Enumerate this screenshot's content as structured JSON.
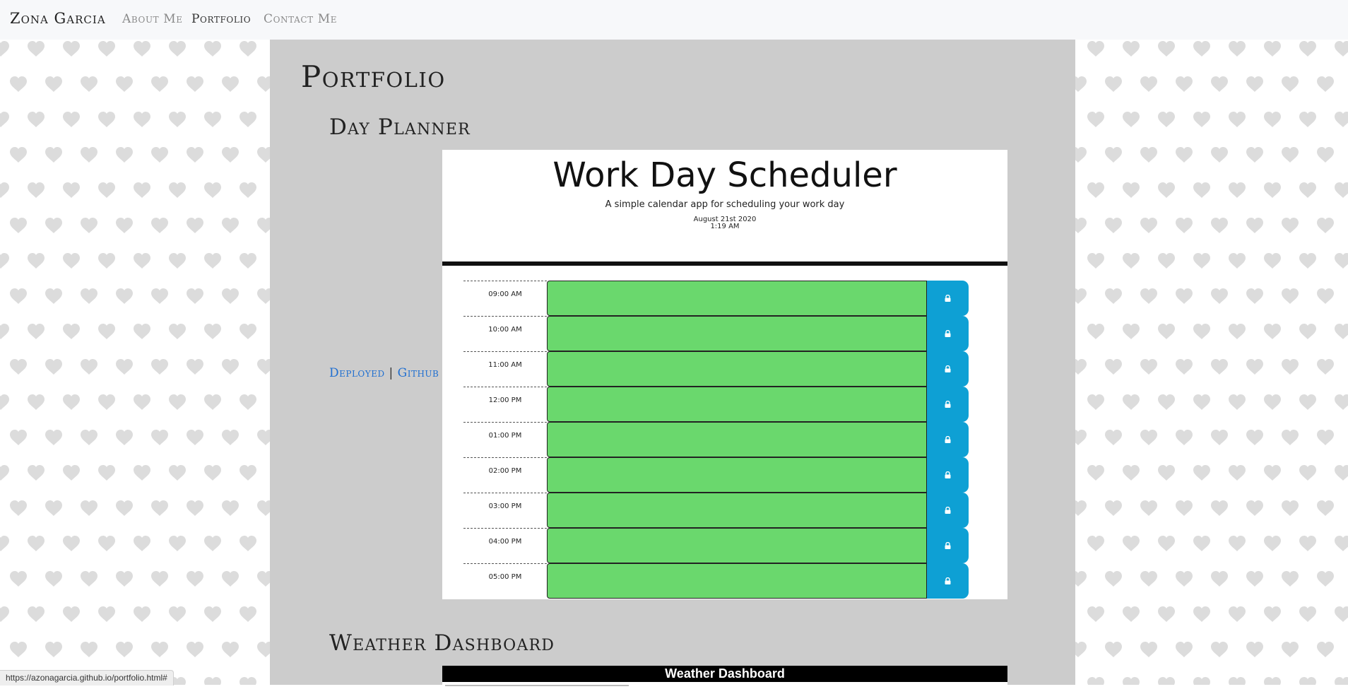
{
  "colors": {
    "page_bg": "#ffffff",
    "heart": "#dcdcdc",
    "navbar_bg": "#f7f8fa",
    "panel_bg": "#cccccc",
    "link": "#1f6fd1",
    "hour_block": "#6ad86d",
    "save_button": "#0ea0d4"
  },
  "navbar": {
    "brand": "Zona Garcia",
    "links": [
      {
        "label": "About Me",
        "active": false
      },
      {
        "label": "Portfolio",
        "active": true
      },
      {
        "label": "Contact Me",
        "active": false
      }
    ]
  },
  "main": {
    "title": "Portfolio",
    "projects": [
      {
        "title": "Day Planner",
        "deployed_label": "Deployed",
        "separator": "|",
        "github_label": "Github",
        "screenshot": {
          "title": "Work Day Scheduler",
          "subtitle": "A simple calendar app for scheduling your work day",
          "date": "August 21st 2020",
          "time": "1:19 AM",
          "hours": [
            "09:00 AM",
            "10:00 AM",
            "11:00 AM",
            "12:00 PM",
            "01:00 PM",
            "02:00 PM",
            "03:00 PM",
            "04:00 PM",
            "05:00 PM"
          ],
          "save_icon": "lock-icon"
        }
      },
      {
        "title": "Weather Dashboard",
        "screenshot": {
          "header": "Weather Dashboard"
        }
      }
    ]
  },
  "statusbar": {
    "url": "https://azonagarcia.github.io/portfolio.html#"
  }
}
